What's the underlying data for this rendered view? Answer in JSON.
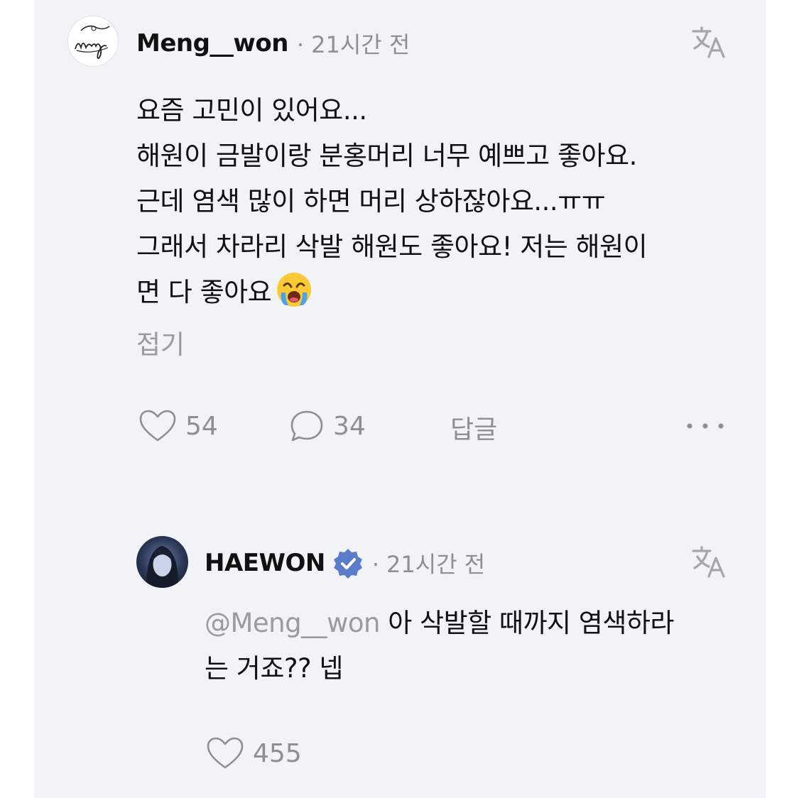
{
  "comment": {
    "username": "Meng__won",
    "time": "21시간 전",
    "body_lines": [
      "요즘 고민이 있어요...",
      "해원이 금발이랑 분홍머리 너무 예쁘고 좋아요.",
      "근데 염색 많이 하면 머리 상하잖아요...ㅠㅠ",
      "그래서 차라리 삭발 해원도 좋아요! 저는 해원이",
      "면 다 좋아요"
    ],
    "collapse_label": "접기",
    "likes": "54",
    "replies_count": "34",
    "reply_label": "답글"
  },
  "reply": {
    "username": "HAEWON",
    "time": "21시간 전",
    "mention": "@Meng__won",
    "body_line1": " 아 삭발할 때까지 염색하라",
    "body_line2": "는 거죠?? 넵",
    "likes": "455"
  },
  "icons": {
    "translate": "translate-icon",
    "heart": "heart-icon",
    "comment": "comment-bubble-icon",
    "more": "more-options-icon",
    "verified": "verified-badge-icon",
    "emoji": "loudly-crying-face-emoji"
  },
  "colors": {
    "panel_bg": "#f2f3f6",
    "text": "#111111",
    "meta": "#8e8e93",
    "verified": "#5b7cc9"
  }
}
